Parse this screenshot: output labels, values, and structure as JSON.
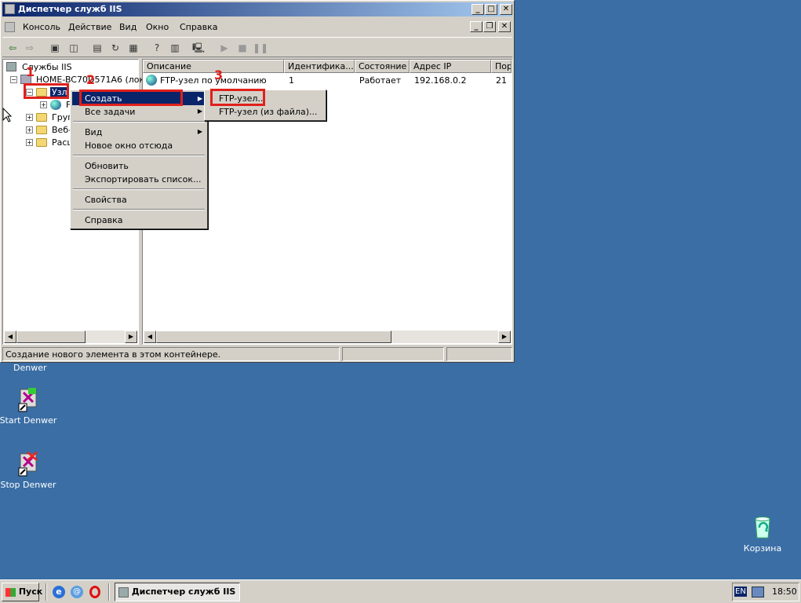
{
  "window": {
    "title": "Диспетчер служб IIS",
    "controls": {
      "minimize": "_",
      "maximize": "□",
      "close": "✕"
    }
  },
  "menubar": {
    "items": [
      "Консоль",
      "Действие",
      "Вид",
      "Окно",
      "Справка"
    ]
  },
  "tree": {
    "root": "Службы IIS",
    "computer": "HOME-BC70D571A6 (лока",
    "sites_short": "Узл",
    "ftp_child_short": "F",
    "groups_short": "Груп",
    "web_short": "Веб-",
    "ext_short": "Расш"
  },
  "list": {
    "columns": [
      "Описание",
      "Идентифика...",
      "Состояние",
      "Адрес IP",
      "Пор"
    ],
    "rows": [
      {
        "description": "FTP-узел по умолчанию",
        "id": "1",
        "state": "Работает",
        "ip": "192.168.0.2",
        "port": "21"
      }
    ]
  },
  "context_menu": {
    "items": [
      "Создать",
      "Все задачи",
      "Вид",
      "Новое окно отсюда",
      "Обновить",
      "Экспортировать список...",
      "Свойства",
      "Справка"
    ]
  },
  "submenu": {
    "items": [
      "FTP-узел...",
      "FTP-узел (из файла)..."
    ]
  },
  "annotations": {
    "n1": "1",
    "n2": "2",
    "n3": "3"
  },
  "statusbar": {
    "text": "Создание нового элемента в этом контейнере."
  },
  "desktop": {
    "partial_label": "Denwer",
    "icons": [
      {
        "label": "Start Denwer"
      },
      {
        "label": "Stop Denwer"
      },
      {
        "label": "Корзина"
      }
    ]
  },
  "taskbar": {
    "start": "Пуск",
    "task": "Диспетчер служб IIS",
    "lang": "EN",
    "clock": "18:50"
  },
  "colors": {
    "desktop": "#3a6ea5",
    "title_active": "#0a246a",
    "highlight": "#0a246a",
    "annotation_red": "#e0201b"
  }
}
